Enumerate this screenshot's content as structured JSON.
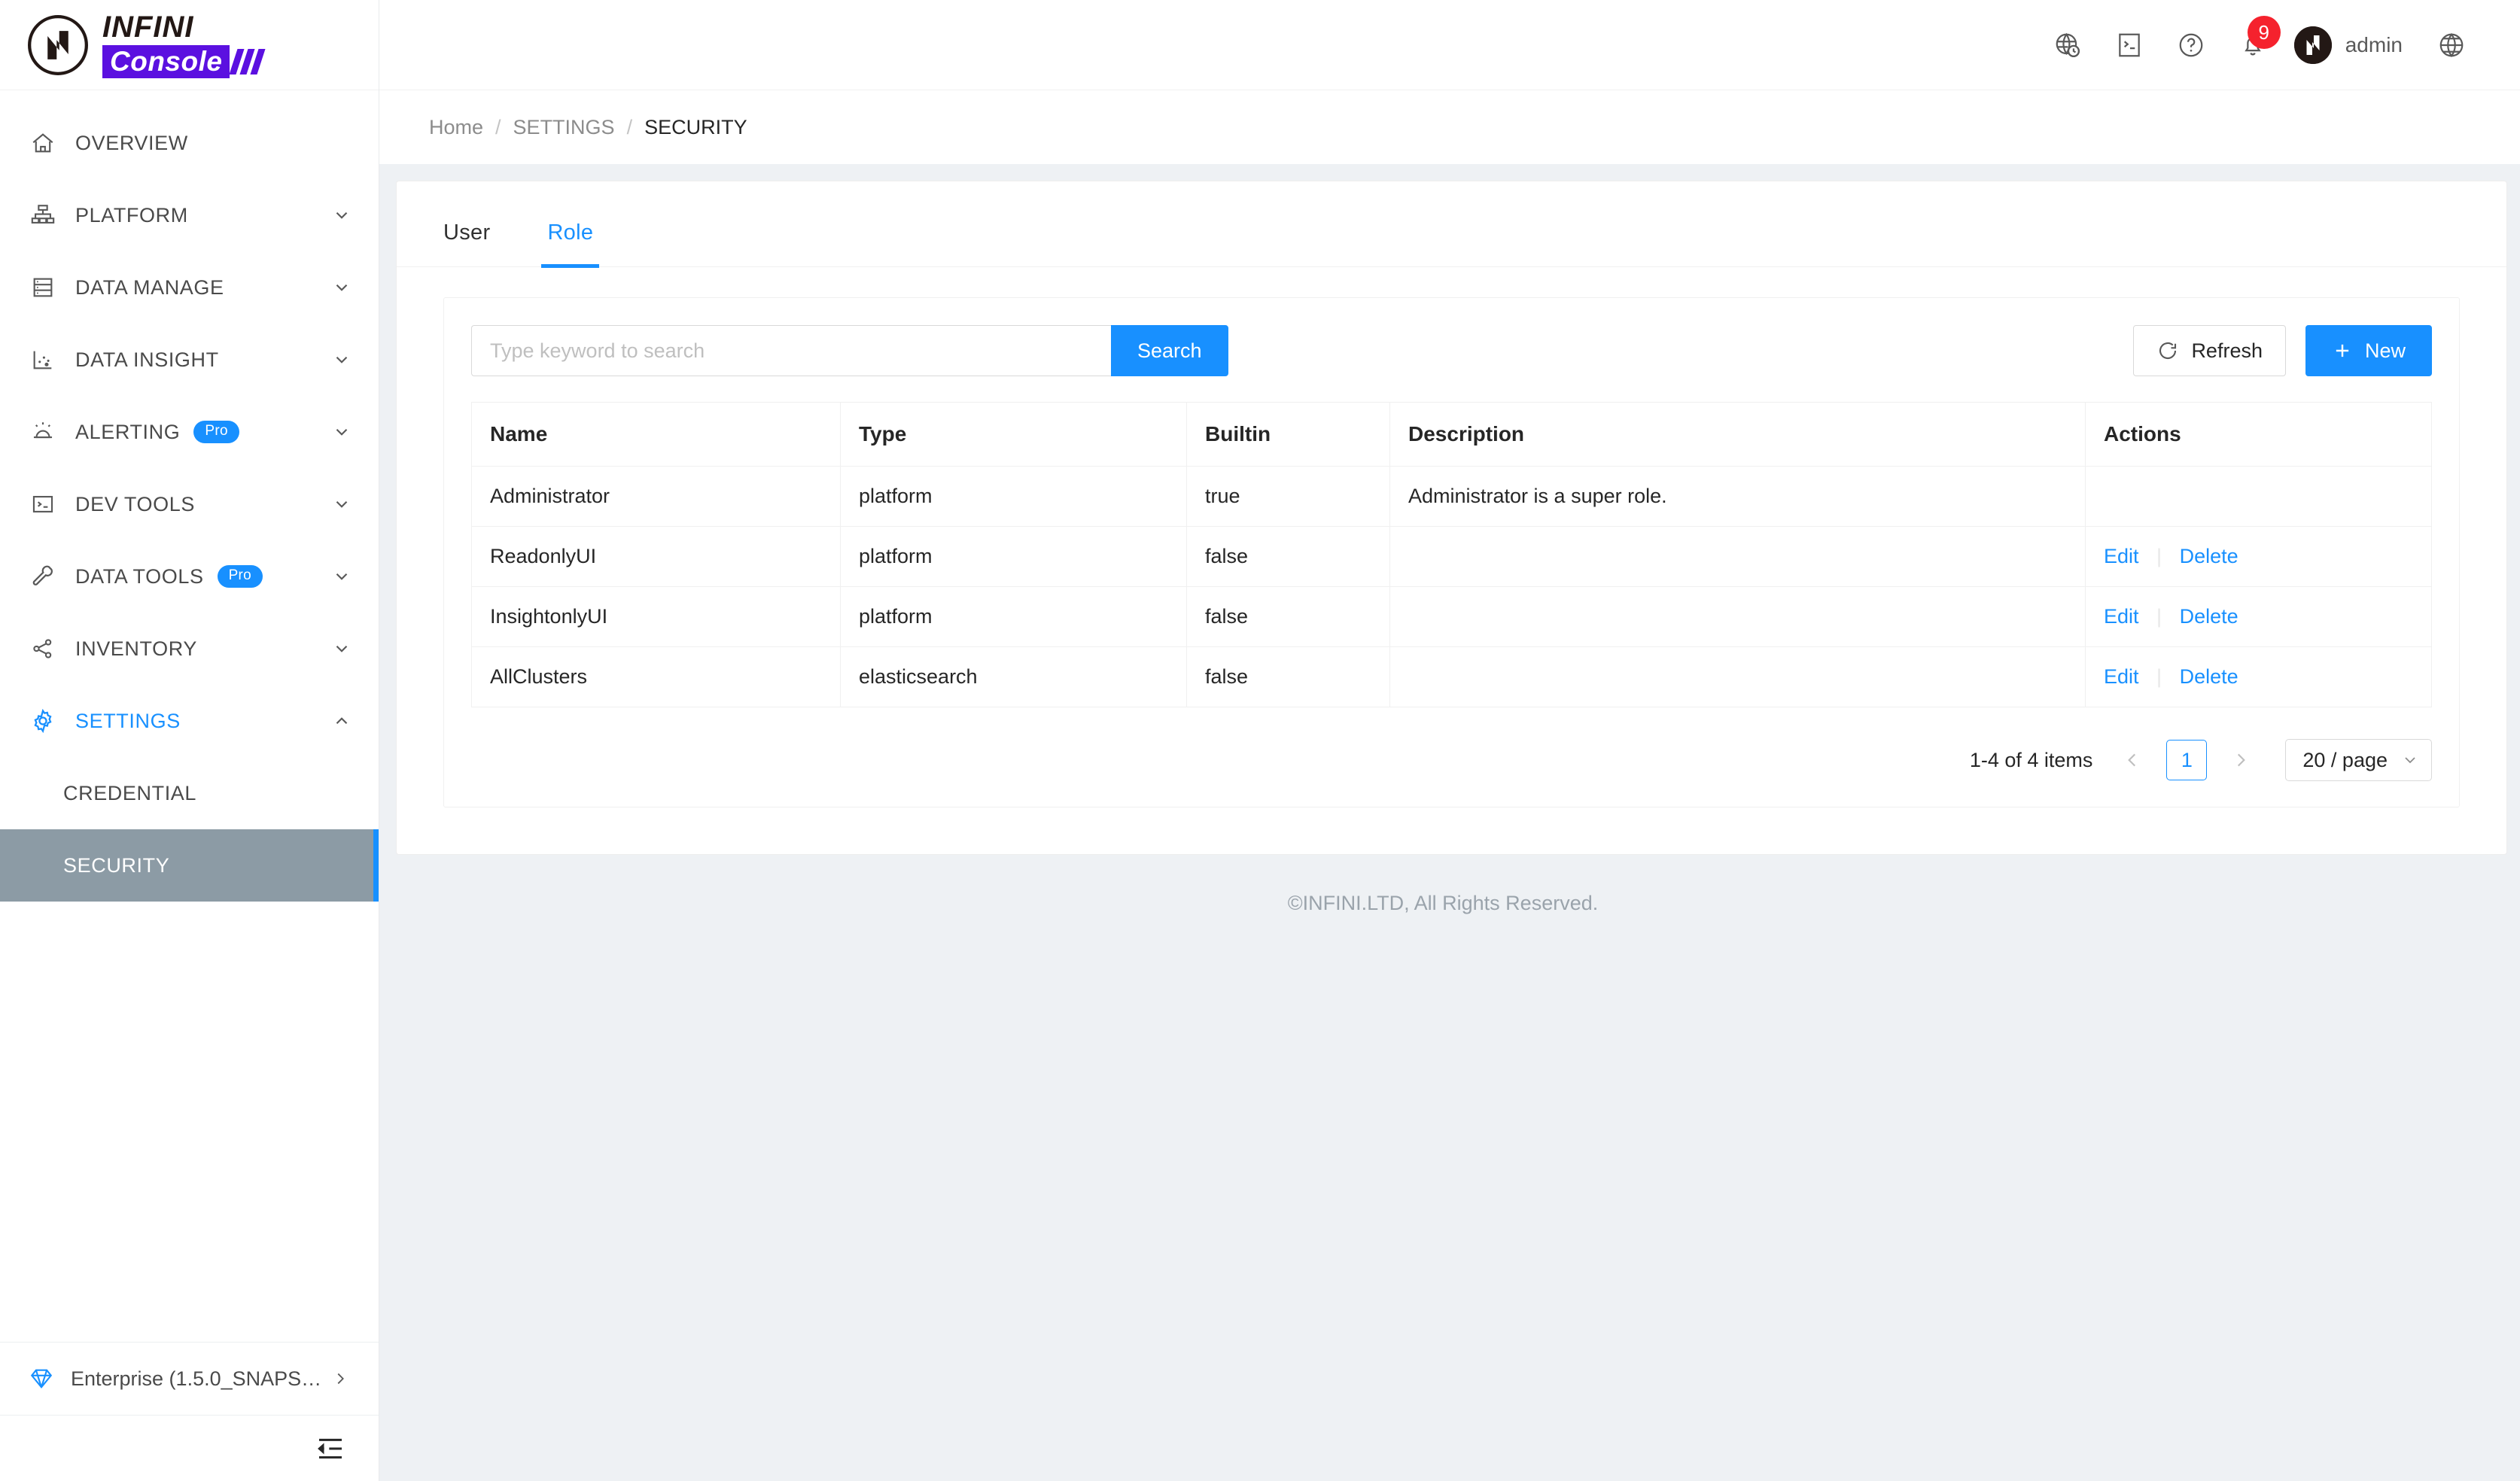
{
  "brand": {
    "line1": "INFINI",
    "line2": "Console",
    "logo_icon": "infini-n-logo",
    "accent_color": "#5b10e0"
  },
  "sidebar": {
    "items": [
      {
        "label": "OVERVIEW",
        "icon": "home-icon",
        "expandable": false,
        "badge": null
      },
      {
        "label": "PLATFORM",
        "icon": "sitemap-icon",
        "expandable": true,
        "badge": null
      },
      {
        "label": "DATA MANAGE",
        "icon": "database-icon",
        "expandable": true,
        "badge": null
      },
      {
        "label": "DATA INSIGHT",
        "icon": "scatter-chart-icon",
        "expandable": true,
        "badge": null
      },
      {
        "label": "ALERTING",
        "icon": "alarm-icon",
        "expandable": true,
        "badge": "Pro"
      },
      {
        "label": "DEV TOOLS",
        "icon": "terminal-icon",
        "expandable": true,
        "badge": null
      },
      {
        "label": "DATA TOOLS",
        "icon": "wrench-icon",
        "expandable": true,
        "badge": "Pro"
      },
      {
        "label": "INVENTORY",
        "icon": "share-nodes-icon",
        "expandable": true,
        "badge": null
      },
      {
        "label": "SETTINGS",
        "icon": "gear-icon",
        "expandable": true,
        "badge": null,
        "active": true
      }
    ],
    "sub_items": [
      {
        "label": "CREDENTIAL",
        "selected": false
      },
      {
        "label": "SECURITY",
        "selected": true
      }
    ],
    "license": {
      "label": "Enterprise (1.5.0_SNAPS…",
      "icon": "diamond-icon",
      "arrow": "chevron-right-icon"
    },
    "collapse_icon": "menu-fold-icon",
    "selected_color": "#8c9ba5",
    "accent_color": "#1890ff"
  },
  "topbar": {
    "icons": [
      {
        "name": "globe-clock-icon",
        "label": ""
      },
      {
        "name": "console-icon",
        "label": ""
      },
      {
        "name": "help-circle-icon",
        "label": ""
      },
      {
        "name": "bell-icon",
        "label": "",
        "badge": "9"
      }
    ],
    "notification_badge": "9",
    "badge_color": "#f5222d",
    "user": {
      "name": "admin",
      "avatar_icon": "infini-avatar-icon"
    },
    "language_icon": "globe-icon"
  },
  "breadcrumb": {
    "items": [
      "Home",
      "SETTINGS",
      "SECURITY"
    ],
    "separator": "/"
  },
  "tabs": [
    {
      "label": "User",
      "active": false
    },
    {
      "label": "Role",
      "active": true
    }
  ],
  "toolbar": {
    "search_placeholder": "Type keyword to search",
    "search_value": "",
    "search_label": "Search",
    "refresh_label": "Refresh",
    "refresh_icon": "refresh-icon",
    "new_label": "New",
    "new_icon": "plus-icon"
  },
  "table": {
    "columns": [
      "Name",
      "Type",
      "Builtin",
      "Description",
      "Actions"
    ],
    "rows": [
      {
        "name": "Administrator",
        "type": "platform",
        "builtin": "true",
        "description": "Administrator is a super role.",
        "actions": []
      },
      {
        "name": "ReadonlyUI",
        "type": "platform",
        "builtin": "false",
        "description": "",
        "actions": [
          "Edit",
          "Delete"
        ]
      },
      {
        "name": "InsightonlyUI",
        "type": "platform",
        "builtin": "false",
        "description": "",
        "actions": [
          "Edit",
          "Delete"
        ]
      },
      {
        "name": "AllClusters",
        "type": "elasticsearch",
        "builtin": "false",
        "description": "",
        "actions": [
          "Edit",
          "Delete"
        ]
      }
    ],
    "action_edit": "Edit",
    "action_delete": "Delete"
  },
  "pagination": {
    "total_text": "1-4 of 4 items",
    "prev_icon": "chevron-left-icon",
    "next_icon": "chevron-right-icon",
    "current_page": "1",
    "page_size": "20 / page",
    "page_size_icon": "chevron-down-icon"
  },
  "footer": {
    "copyright": "©INFINI.LTD, All Rights Reserved."
  }
}
